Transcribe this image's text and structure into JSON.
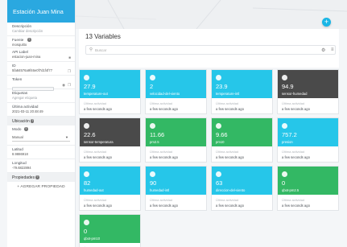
{
  "colors": {
    "header_blue": "#2aa8e0",
    "cyan": "#26c6e9",
    "green": "#33b864",
    "dark": "#4a4a4a",
    "fab": "#19b6e6"
  },
  "sidebar": {
    "device_name": "Estación Juan Mina",
    "fields": [
      {
        "label": "Descripción",
        "value": "Cambiar descripción"
      },
      {
        "label": "Fuente",
        "value": "mosquitto"
      },
      {
        "label": "API Label",
        "value": "estacion-juan-mina"
      },
      {
        "label": "ID",
        "value": "5fa84576a9f46e0f7d1f4f77"
      },
      {
        "label": "Token",
        "value": ""
      },
      {
        "label": "Etiquetas",
        "value": "Agregar etiqueta"
      },
      {
        "label": "Última actividad",
        "value": "2021-03-11 20:48:49"
      }
    ],
    "ubicacion": {
      "title": "Ubicación",
      "mode_label": "Modo",
      "mode_value": "Manual",
      "lat_label": "Latitud",
      "lat_value": "8.9886918",
      "lng_label": "Longitud",
      "lng_value": "-79.6822894"
    },
    "propiedades": {
      "title": "Propiedades",
      "add_label": "+ AGREGAR PROPIEDAD"
    }
  },
  "main": {
    "title": "13 Variables",
    "search_placeholder": "Buscar",
    "add_label": "+",
    "settings_icon": "gear-icon",
    "list_icon": "list-icon"
  },
  "variables": [
    {
      "value": "27.9",
      "name": "temperature-out",
      "last_activity_label": "Última actividad",
      "last_activity": "a few seconds ago",
      "color": "cyan"
    },
    {
      "value": "2",
      "name": "velocidad-del-viento",
      "last_activity_label": "Última actividad",
      "last_activity": "a few seconds ago",
      "color": "cyan"
    },
    {
      "value": "23.9",
      "name": "temperature-intl",
      "last_activity_label": "Última actividad",
      "last_activity": "a few seconds ago",
      "color": "cyan"
    },
    {
      "value": "94.9",
      "name": "sensor-humedad",
      "last_activity_label": "Última actividad",
      "last_activity": "a few seconds ago",
      "color": "dark"
    },
    {
      "value": "22.6",
      "name": "sensor-temperatura",
      "last_activity_label": "Última actividad",
      "last_activity": "a few seconds ago",
      "color": "dark"
    },
    {
      "value": "11.66",
      "name": "pm2.5",
      "last_activity_label": "Última actividad",
      "last_activity": "a few seconds ago",
      "color": "green"
    },
    {
      "value": "9.66",
      "name": "pm10",
      "last_activity_label": "Última actividad",
      "last_activity": "a few seconds ago",
      "color": "green"
    },
    {
      "value": "757.2",
      "name": "presion",
      "last_activity_label": "Última actividad",
      "last_activity": "a few seconds ago",
      "color": "cyan"
    },
    {
      "value": "82",
      "name": "humedad-out",
      "last_activity_label": "Última actividad",
      "last_activity": "a few seconds ago",
      "color": "cyan"
    },
    {
      "value": "90",
      "name": "humedad-intl",
      "last_activity_label": "Última actividad",
      "last_activity": "a few seconds ago",
      "color": "cyan"
    },
    {
      "value": "63",
      "name": "direccion-del-viento",
      "last_activity_label": "Última actividad",
      "last_activity": "a few seconds ago",
      "color": "cyan"
    },
    {
      "value": "0",
      "name": "qbot-pm2.5",
      "last_activity_label": "Última actividad",
      "last_activity": "a few seconds ago",
      "color": "green"
    },
    {
      "value": "0",
      "name": "qbot-pm10",
      "last_activity_label": "Última actividad",
      "last_activity": "a few seconds ago",
      "color": "green"
    }
  ]
}
